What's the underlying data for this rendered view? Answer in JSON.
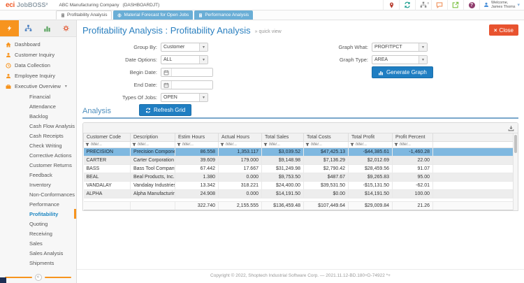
{
  "icons": {
    "caret_down": "▾",
    "close_x": "×",
    "collapse": "«",
    "help_mark": "?",
    "hierarchy_badge": "0"
  },
  "header": {
    "logo_eci": "eci",
    "logo_product": "JobBOSS²",
    "company": "ABC Manufacturing Company",
    "dashboard_tag": "(DASHBOARDJT)",
    "welcome_line1": "Welcome,",
    "welcome_line2": "James Thoms"
  },
  "tabs": [
    {
      "label": "Profitability Analysis"
    },
    {
      "label": "Material Forecast for Open Jobs"
    },
    {
      "label": "Performance Analysis"
    }
  ],
  "sidebar": {
    "items": [
      {
        "label": "Dashboard"
      },
      {
        "label": "Customer Inquiry"
      },
      {
        "label": "Data Collection"
      },
      {
        "label": "Employee Inquiry"
      },
      {
        "label": "Executive Overview"
      }
    ],
    "subitems": [
      "Financial",
      "Attendance",
      "Backlog",
      "Cash Flow Analysis",
      "Cash Receipts",
      "Check Writing",
      "Corrective Actions",
      "Customer Returns",
      "Feedback",
      "Inventory",
      "Non-Conformances",
      "Performance",
      "Profitability",
      "Quoting",
      "Receiving",
      "Sales",
      "Sales Analysis",
      "Shipments"
    ],
    "active_subitem": "Profitability"
  },
  "page": {
    "title": "Profitability Analysis : Profitability Analysis",
    "quick_view": "» quick view",
    "close_label": "Close"
  },
  "form": {
    "group_by_label": "Group By:",
    "group_by_value": "Customer",
    "date_options_label": "Date Options:",
    "date_options_value": "ALL",
    "begin_date_label": "Begin Date:",
    "begin_date_value": "",
    "end_date_label": "End Date:",
    "end_date_value": "",
    "types_of_jobs_label": "Types Of Jobs:",
    "types_of_jobs_value": "OPEN",
    "refresh_button": "Refresh Grid",
    "graph_what_label": "Graph What:",
    "graph_what_value": "PROFITPCT",
    "graph_type_label": "Graph Type:",
    "graph_type_value": "AREA",
    "generate_button": "Generate Graph"
  },
  "analysis": {
    "section_title": "Analysis",
    "filter_placeholder": "filter...",
    "columns": [
      "Customer Code",
      "Description",
      "Estim Hours",
      "Actual Hours",
      "Total Sales",
      "Total Costs",
      "Total Profit",
      "Profit Percent"
    ],
    "rows": [
      {
        "cells": [
          "PRECISION",
          "Precision Components,...",
          "86.558",
          "1,353.117",
          "$3,039.52",
          "$47,425.13",
          "-$44,385.61",
          "-1,460.28"
        ],
        "selected": true
      },
      {
        "cells": [
          "CARTER",
          "Carter Corporation",
          "39.609",
          "179.000",
          "$9,148.98",
          "$7,136.29",
          "$2,012.69",
          "22.00"
        ]
      },
      {
        "cells": [
          "BASS",
          "Bass Tool Company",
          "67.442",
          "17.667",
          "$31,249.98",
          "$2,790.42",
          "$28,459.56",
          "91.07"
        ]
      },
      {
        "cells": [
          "BEAL",
          "Beal Products, Inc.",
          "1.380",
          "0.000",
          "$9,753.50",
          "$487.67",
          "$9,265.83",
          "95.00"
        ]
      },
      {
        "cells": [
          "VANDALAY",
          "Vandalay Industries, Inc.",
          "13.342",
          "318.221",
          "$24,400.00",
          "$39,531.50",
          "-$15,131.50",
          "-62.01"
        ]
      },
      {
        "cells": [
          "ALPHA",
          "Alpha Manufacturing, I...",
          "24.908",
          "0.000",
          "$14,191.50",
          "$0.00",
          "$14,191.50",
          "100.00"
        ]
      }
    ],
    "totals": [
      "",
      "",
      "322.740",
      "2,155.555",
      "$136,459.48",
      "$107,449.64",
      "$29,009.84",
      "21.26"
    ]
  },
  "footer": {
    "copyright": "Copyright © 2022, Shoptech Industrial Software Corp. — 2021.11.12-BD.180+D-74922 *+"
  }
}
